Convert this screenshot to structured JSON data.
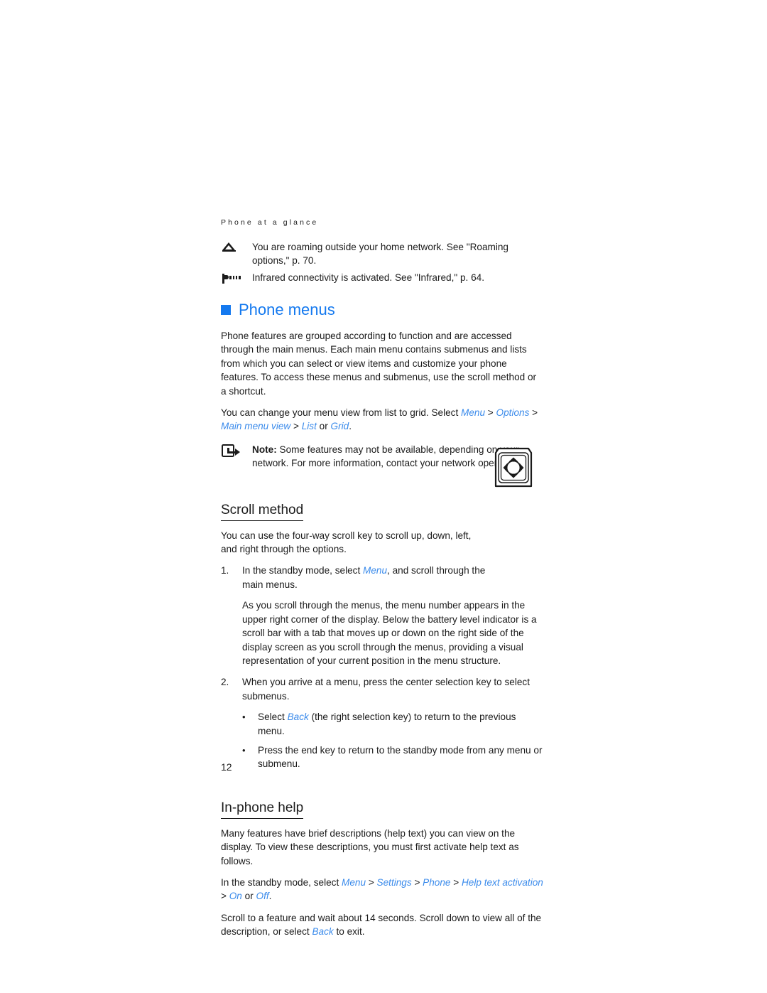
{
  "page": {
    "running_header": "Phone at a glance",
    "page_number": "12",
    "accent_color": "#1479ef",
    "link_color": "#3b8beb",
    "text_color": "#1a1a1a"
  },
  "indicators": [
    {
      "icon": "roaming-triangle-icon",
      "text": "You are roaming outside your home network. See \"Roaming options,\" p. 70."
    },
    {
      "icon": "infrared-icon",
      "text": "Infrared connectivity is activated. See \"Infrared,\" p. 64."
    }
  ],
  "chapter": {
    "bullet": "square-bullet-icon",
    "title": "Phone menus",
    "intro": "Phone features are grouped according to function and are accessed through the main menus. Each main menu contains submenus and lists from which you can select or view items and customize your phone features. To access these menus and submenus, use the scroll method or a shortcut.",
    "menu_view_lead": "You can change your menu view from list to grid. Select ",
    "menu_view_path": {
      "item1": "Menu",
      "item2": "Options",
      "item3": "Main menu view",
      "item4": "List",
      "or": " or ",
      "item5": "Grid",
      "separator": " > ",
      "period": "."
    }
  },
  "note": {
    "icon": "note-arrow-icon",
    "label": "Note:",
    "text": " Some features may not be available, depending on your network. For more information, contact your network operator."
  },
  "scroll_method": {
    "heading": "Scroll method",
    "intro": "You can use the four-way scroll key to scroll up, down, left, and right through the options.",
    "illustration": "four-way-scroll-key-illustration",
    "step1": {
      "marker": "1.",
      "lead": "In the standby mode, select ",
      "link": "Menu",
      "tail": ", and scroll through the main menus."
    },
    "step1_detail": "As you scroll through the menus, the menu number appears in the upper right corner of the display. Below the battery level indicator is a scroll bar with a tab that moves up or down on the right side of the display screen as you scroll through the menus, providing a visual representation of your current position in the menu structure.",
    "step2": {
      "marker": "2.",
      "text": "When you arrive at a menu, press the center selection key to select submenus."
    },
    "bullets": [
      {
        "dot": "•",
        "lead": "Select ",
        "link": "Back",
        "tail": " (the right selection key) to return to the previous menu."
      },
      {
        "dot": "•",
        "lead": "Press the end key to return to the standby mode from any menu or submenu.",
        "link": "",
        "tail": ""
      }
    ]
  },
  "in_phone_help": {
    "heading": "In-phone help",
    "intro": "Many features have brief descriptions (help text) you can view on the display. To view these descriptions, you must first activate help text as follows.",
    "path_lead": "In the standby mode, select ",
    "path": {
      "item1": "Menu",
      "item2": "Settings",
      "item3": "Phone",
      "item4": "Help text activation",
      "item5": "On",
      "or": " or ",
      "item6": "Off",
      "separator": " > ",
      "period": "."
    },
    "outro_lead": "Scroll to a feature and wait about 14 seconds. Scroll down to view all of the description, or select ",
    "outro_link": "Back",
    "outro_tail": " to exit."
  }
}
